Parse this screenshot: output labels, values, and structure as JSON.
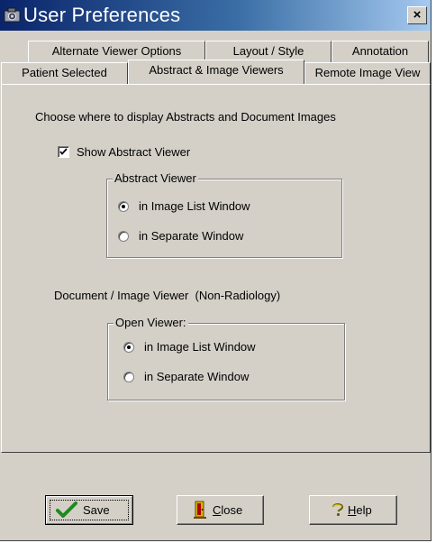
{
  "window": {
    "title": "User Preferences",
    "close_glyph": "×"
  },
  "tabs_row1": [
    {
      "label": "Alternate Viewer Options"
    },
    {
      "label": "Layout / Style"
    },
    {
      "label": "Annotation"
    }
  ],
  "tabs_row2": [
    {
      "label": "Patient Selected"
    },
    {
      "label": "Abstract & Image Viewers",
      "active": true
    },
    {
      "label": "Remote Image View"
    }
  ],
  "panel": {
    "heading": "Choose where to display Abstracts and Document Images",
    "show_abstract": {
      "label": "Show Abstract Viewer",
      "checked": true
    },
    "abstract_group": {
      "legend": "Abstract Viewer",
      "options": [
        {
          "label": "in Image List Window",
          "selected": true
        },
        {
          "label": "in Separate Window",
          "selected": false
        }
      ]
    },
    "document_heading": "Document / Image Viewer  (Non-Radiology)",
    "document_group": {
      "legend": "Open Viewer:",
      "options": [
        {
          "label": "in Image List Window",
          "selected": true
        },
        {
          "label": "in Separate Window",
          "selected": false
        }
      ]
    }
  },
  "buttons": {
    "save": {
      "label": "Save",
      "icon": "checkmark-icon"
    },
    "close": {
      "label_prefix": "",
      "mnemonic": "C",
      "label_rest": "lose",
      "icon": "close-door-icon"
    },
    "help": {
      "mnemonic": "H",
      "label_rest": "elp",
      "icon": "help-icon"
    }
  }
}
